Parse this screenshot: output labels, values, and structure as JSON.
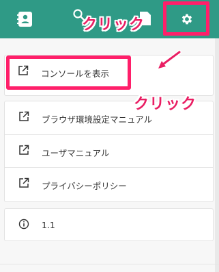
{
  "header": {
    "icons": [
      "contacts-icon",
      "search-icon",
      "document-icon",
      "gear-icon"
    ],
    "click_top": "クリック",
    "bg_color": "#2f9a86"
  },
  "annotations": {
    "click_mid": "クリック",
    "highlight_color": "#ff1f6a"
  },
  "menu": {
    "console": {
      "label": "コンソールを表示",
      "icon": "external-link-icon"
    },
    "links": [
      {
        "label": "ブラウザ環境設定マニュアル",
        "icon": "external-link-icon"
      },
      {
        "label": "ユーザマニュアル",
        "icon": "external-link-icon"
      },
      {
        "label": "プライバシーポリシー",
        "icon": "external-link-icon"
      }
    ],
    "version": {
      "label": "1.1",
      "icon": "info-icon"
    }
  }
}
